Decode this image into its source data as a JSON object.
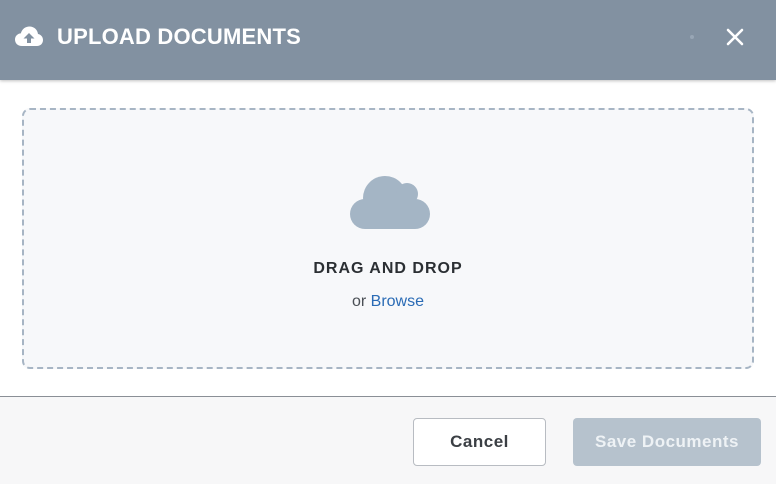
{
  "header": {
    "title": "UPLOAD DOCUMENTS",
    "upload_icon": "cloud-upload-icon",
    "close_icon": "close-icon",
    "background": "#8291a1"
  },
  "dropzone": {
    "icon": "cloud-icon",
    "title": "DRAG AND DROP",
    "or_text": "or",
    "browse_label": "Browse",
    "link_color": "#2a6bb5"
  },
  "footer": {
    "cancel_label": "Cancel",
    "save_label": "Save Documents",
    "save_disabled": true
  }
}
